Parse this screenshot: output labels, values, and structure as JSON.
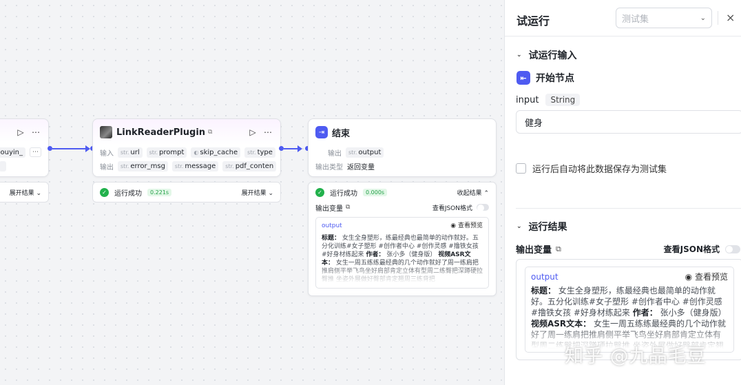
{
  "node_prev": {
    "row1_tag": "ouyin_",
    "row1_more": "⋯",
    "result_expand": "展开结果"
  },
  "node_link": {
    "title": "LinkReaderPlugin",
    "input_label": "输入",
    "inputs": [
      "url",
      "prompt",
      "skip_cache",
      "type"
    ],
    "output_label": "输出",
    "outputs": [
      "error_msg",
      "message",
      "pdf_conten"
    ],
    "type_prefix": "str.",
    "more": "⋯",
    "result_status": "运行成功",
    "result_time": "0.221s",
    "result_expand": "展开结果"
  },
  "node_end": {
    "title": "结束",
    "output_label": "输出",
    "output_var": "output",
    "type_prefix": "str.",
    "output_type_label": "输出类型",
    "output_type_value": "返回变量",
    "result_status": "运行成功",
    "result_time": "0.000s",
    "collapse_label": "收起结果",
    "output_vars_label": "输出变量",
    "json_view_label": "查看JSON格式",
    "output_name": "output",
    "preview_label": "查看预览",
    "output_text_1_label": "标题：",
    "output_text_1": "女生全身塑形，练最经典也最简单的动作就好。五分化训练#女子塑形 #创作者中心 #创作灵感 #撸铁女孩 #好身材练起来",
    "output_text_2_label": "作者：",
    "output_text_2": "张小多（健身版）",
    "output_text_3_label": "视频ASR文本：",
    "output_text_3": "女生一周五练练最经典的几个动作就好了周一练肩把推肩侧平举飞鸟坐好肩部肯定立体有型周二练臀把深蹲硬拉臀推 坐姿外展做好臀部肯定翘周三练背把"
  },
  "panel": {
    "title": "试运行",
    "select_placeholder": "测试集",
    "close": "×",
    "input_section": "试运行输入",
    "start_node": "开始节点",
    "field_name": "input",
    "field_type": "String",
    "field_value": "健身",
    "save_checkbox_label": "运行后自动将此数据保存为测试集",
    "result_section": "运行结果",
    "output_vars_label": "输出变量",
    "json_view_label": "查看JSON格式",
    "output_name": "output",
    "preview_label": "查看预览",
    "output_text_1_label": "标题：",
    "output_text_1": "女生全身塑形，练最经典也最简单的动作就好。五分化训练#女子塑形 #创作者中心 #创作灵感 #撸铁女孩 #好身材练起来",
    "output_text_2_label": "作者：",
    "output_text_2": "张小多（健身版）",
    "output_text_3_label": "视频ASR文本：",
    "output_text_3": "女生一周五练练最经典的几个动作就好了周一练肩把推肩侧平举飞鸟坐好肩部肯定立体有型周二练臀把深蹲硬拉臀推 坐姿外展做好臀部肯定翘周三练背把"
  },
  "watermark": "知乎 @九品毛豆",
  "colors": {
    "accent": "#4e5bf1",
    "success": "#22b14c"
  }
}
